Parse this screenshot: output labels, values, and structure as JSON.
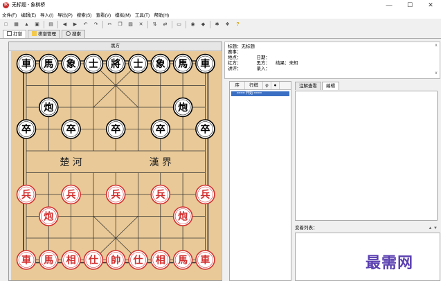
{
  "window": {
    "title": "无标题 - 象棋桥",
    "controls": [
      "—",
      "☐",
      "✕"
    ]
  },
  "menu": [
    "文件(F)",
    "编辑(E)",
    "导入(I)",
    "导出(P)",
    "搜索(S)",
    "查看(V)",
    "模拟(M)",
    "工具(T)",
    "帮助(H)"
  ],
  "toolbar": {
    "buttons": [
      {
        "icon": "new-icon",
        "glyph": "□"
      },
      {
        "icon": "board-icon",
        "glyph": "▦"
      },
      {
        "icon": "open-icon",
        "glyph": "▲"
      },
      {
        "icon": "save-icon",
        "glyph": "▣"
      },
      {
        "icon": "sep"
      },
      {
        "icon": "print-icon",
        "glyph": "▤"
      },
      {
        "icon": "sep"
      },
      {
        "icon": "back-icon",
        "glyph": "◀"
      },
      {
        "icon": "forward-icon",
        "glyph": "▶"
      },
      {
        "icon": "undo-icon",
        "glyph": "↶"
      },
      {
        "icon": "redo-icon",
        "glyph": "↷"
      },
      {
        "icon": "sep"
      },
      {
        "icon": "cut-icon",
        "glyph": "✂"
      },
      {
        "icon": "copy-icon",
        "glyph": "❐"
      },
      {
        "icon": "paste-icon",
        "glyph": "▧"
      },
      {
        "icon": "delete-icon",
        "glyph": "✕"
      },
      {
        "icon": "sep"
      },
      {
        "icon": "flip-icon",
        "glyph": "⇅"
      },
      {
        "icon": "swap-icon",
        "glyph": "⇄"
      },
      {
        "icon": "sep"
      },
      {
        "icon": "window-icon",
        "glyph": "▭"
      },
      {
        "icon": "sep"
      },
      {
        "icon": "engine-icon",
        "glyph": "◉"
      },
      {
        "icon": "tag-icon",
        "glyph": "◆"
      },
      {
        "icon": "sep"
      },
      {
        "icon": "analysis-icon",
        "glyph": "✱"
      },
      {
        "icon": "library-icon",
        "glyph": "❖"
      },
      {
        "icon": "help-icon",
        "glyph": "?"
      }
    ]
  },
  "tabs": [
    {
      "label": "打谱",
      "icon": "notation-icon",
      "active": true
    },
    {
      "label": "棋谱管理",
      "icon": "folder-icon",
      "active": false
    },
    {
      "label": "搜索",
      "icon": "search-icon",
      "active": false
    }
  ],
  "board": {
    "header": "黑方",
    "top_numbers": [
      "1",
      "2",
      "3",
      "4",
      "5",
      "6",
      "7",
      "8",
      "9"
    ],
    "river_left": "楚  河",
    "river_right": "漢  界",
    "colors": {
      "black": "#000000",
      "red": "#d32f2f",
      "wood": "#e9c997"
    },
    "pieces": [
      {
        "side": "black",
        "text": "車",
        "col": 0,
        "row": 0
      },
      {
        "side": "black",
        "text": "馬",
        "col": 1,
        "row": 0
      },
      {
        "side": "black",
        "text": "象",
        "col": 2,
        "row": 0
      },
      {
        "side": "black",
        "text": "士",
        "col": 3,
        "row": 0
      },
      {
        "side": "black",
        "text": "將",
        "col": 4,
        "row": 0
      },
      {
        "side": "black",
        "text": "士",
        "col": 5,
        "row": 0
      },
      {
        "side": "black",
        "text": "象",
        "col": 6,
        "row": 0
      },
      {
        "side": "black",
        "text": "馬",
        "col": 7,
        "row": 0
      },
      {
        "side": "black",
        "text": "車",
        "col": 8,
        "row": 0
      },
      {
        "side": "black",
        "text": "炮",
        "col": 1,
        "row": 2
      },
      {
        "side": "black",
        "text": "炮",
        "col": 7,
        "row": 2
      },
      {
        "side": "black",
        "text": "卒",
        "col": 0,
        "row": 3
      },
      {
        "side": "black",
        "text": "卒",
        "col": 2,
        "row": 3
      },
      {
        "side": "black",
        "text": "卒",
        "col": 4,
        "row": 3
      },
      {
        "side": "black",
        "text": "卒",
        "col": 6,
        "row": 3
      },
      {
        "side": "black",
        "text": "卒",
        "col": 8,
        "row": 3
      },
      {
        "side": "red",
        "text": "兵",
        "col": 0,
        "row": 6
      },
      {
        "side": "red",
        "text": "兵",
        "col": 2,
        "row": 6
      },
      {
        "side": "red",
        "text": "兵",
        "col": 4,
        "row": 6
      },
      {
        "side": "red",
        "text": "兵",
        "col": 6,
        "row": 6
      },
      {
        "side": "red",
        "text": "兵",
        "col": 8,
        "row": 6
      },
      {
        "side": "red",
        "text": "炮",
        "col": 1,
        "row": 7
      },
      {
        "side": "red",
        "text": "炮",
        "col": 7,
        "row": 7
      },
      {
        "side": "red",
        "text": "車",
        "col": 0,
        "row": 9
      },
      {
        "side": "red",
        "text": "馬",
        "col": 1,
        "row": 9
      },
      {
        "side": "red",
        "text": "相",
        "col": 2,
        "row": 9
      },
      {
        "side": "red",
        "text": "仕",
        "col": 3,
        "row": 9
      },
      {
        "side": "red",
        "text": "帥",
        "col": 4,
        "row": 9
      },
      {
        "side": "red",
        "text": "仕",
        "col": 5,
        "row": 9
      },
      {
        "side": "red",
        "text": "相",
        "col": 6,
        "row": 9
      },
      {
        "side": "red",
        "text": "馬",
        "col": 7,
        "row": 9
      },
      {
        "side": "red",
        "text": "車",
        "col": 8,
        "row": 9
      }
    ]
  },
  "info": {
    "title": "标题：无标题",
    "event": "赛事：",
    "place": "地点：",
    "date": "日期：",
    "red": "红方：",
    "black": "黑方：",
    "result": "结果：未知",
    "commentator": "讲评：",
    "recorder": "录入："
  },
  "moves": {
    "columns": [
      "序",
      "行棋",
      "φ",
      "●"
    ],
    "selected_row": "==== 开始 ===="
  },
  "notes": {
    "tabs": [
      "注解查看",
      "编辑"
    ],
    "list_label": "变着列表：",
    "list_arrows": "▲  ▼"
  },
  "watermark": "最需网"
}
